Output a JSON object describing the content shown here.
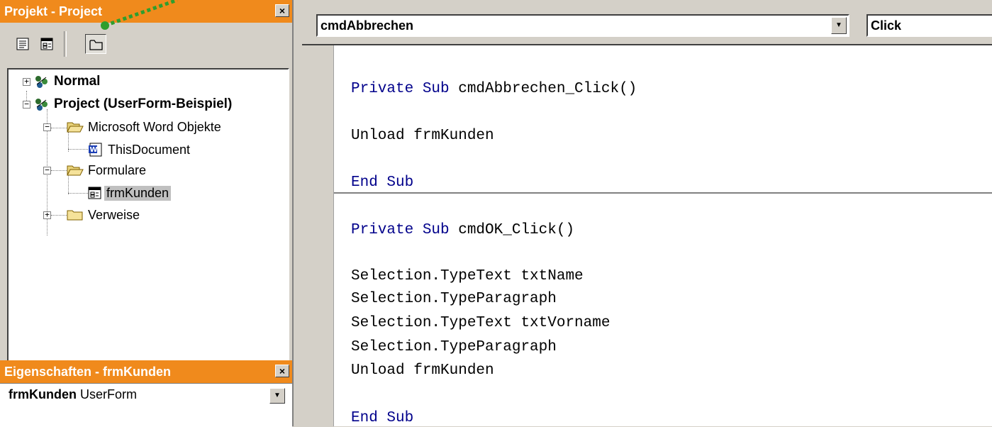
{
  "project_pane": {
    "title": "Projekt - Project",
    "close_glyph": "×",
    "toolbar": [
      "view-code-icon",
      "view-object-icon",
      "toggle-folders-icon"
    ],
    "tree": {
      "normal": "Normal",
      "project": "Project (UserForm-Beispiel)",
      "word_objects": "Microsoft Word Objekte",
      "this_document": "ThisDocument",
      "forms": "Formulare",
      "form_item": "frmKunden",
      "references": "Verweise"
    }
  },
  "properties_pane": {
    "title": "Eigenschaften - frmKunden",
    "close_glyph": "×",
    "object_name": "frmKunden",
    "object_type": "UserForm"
  },
  "code_window": {
    "object_combo": "cmdAbbrechen",
    "procedure_combo": "Click",
    "block1": {
      "sub_kw": "Private Sub",
      "sub_name": " cmdAbbrechen_Click()",
      "body1": "Unload frmKunden",
      "end": "End Sub"
    },
    "block2": {
      "sub_kw": "Private Sub",
      "sub_name": " cmdOK_Click()",
      "body1": "Selection.TypeText txtName",
      "body2": "Selection.TypeParagraph",
      "body3": "Selection.TypeText txtVorname",
      "body4": "Selection.TypeParagraph",
      "body5": "Unload frmKunden",
      "end": "End Sub"
    }
  },
  "colors": {
    "titlebar": "#f08a1c",
    "keyword": "#00008b",
    "window_bg": "#d4d0c8"
  }
}
